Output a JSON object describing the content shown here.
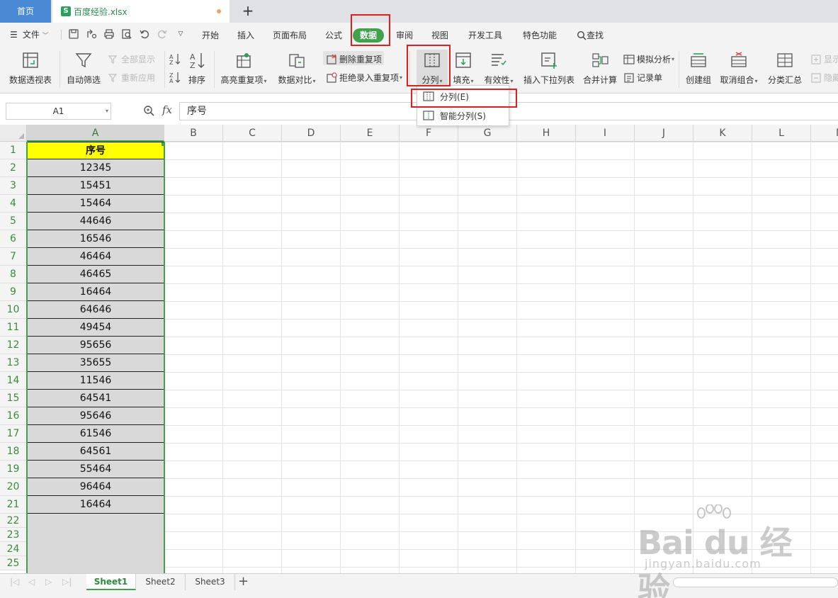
{
  "tabs": {
    "home": "首页",
    "file_icon": "S",
    "file_name": "百度经验.xlsx",
    "new_tab": "+"
  },
  "menu": {
    "file": "文件",
    "tabs": [
      "开始",
      "插入",
      "页面布局",
      "公式",
      "数据",
      "审阅",
      "视图",
      "开发工具",
      "特色功能",
      "查找"
    ],
    "active": "数据"
  },
  "ribbon": {
    "pivot": "数据透视表",
    "autofilter": "自动筛选",
    "show_all": "全部显示",
    "reapply": "重新应用",
    "sort": "排序",
    "highlight_dup": "高亮重复项",
    "compare": "数据对比",
    "delete_dup": "删除重复项",
    "reject_dup": "拒绝录入重复项",
    "split": "分列",
    "fill": "填充",
    "validity": "有效性",
    "insert_dropdown": "插入下拉列表",
    "consolidate": "合并计算",
    "simulate": "模拟分析",
    "record": "记录单",
    "create_group": "创建组",
    "ungroup": "取消组合",
    "subtotal": "分类汇总",
    "show_detail": "显示",
    "hide_detail": "隐藏"
  },
  "dropdown": {
    "items": [
      "分列(E)",
      "智能分列(S)"
    ]
  },
  "formula": {
    "name_box": "A1",
    "fx": "fx",
    "content": "序号"
  },
  "sheet": {
    "columns": [
      "A",
      "B",
      "C",
      "D",
      "E",
      "F",
      "G",
      "H",
      "I",
      "J",
      "K",
      "L",
      "M"
    ],
    "rows": [
      1,
      2,
      3,
      4,
      5,
      6,
      7,
      8,
      9,
      10,
      11,
      12,
      13,
      14,
      15,
      16,
      17,
      18,
      19,
      20,
      21,
      22,
      23,
      24,
      25
    ],
    "header": "序号",
    "values": [
      "12345",
      "15451",
      "15464",
      "44646",
      "16546",
      "46464",
      "46465",
      "16464",
      "64646",
      "49454",
      "95656",
      "35655",
      "11546",
      "64541",
      "95646",
      "61546",
      "64561",
      "55464",
      "96464",
      "16464"
    ]
  },
  "sheet_tabs": [
    "Sheet1",
    "Sheet2",
    "Sheet3"
  ],
  "watermark": {
    "logo": "Bai du 经验",
    "url": "jingyan.baidu.com"
  },
  "colors": {
    "accent": "#3fa34d",
    "highlight": "#e02020",
    "header_fill": "#ffff00"
  }
}
